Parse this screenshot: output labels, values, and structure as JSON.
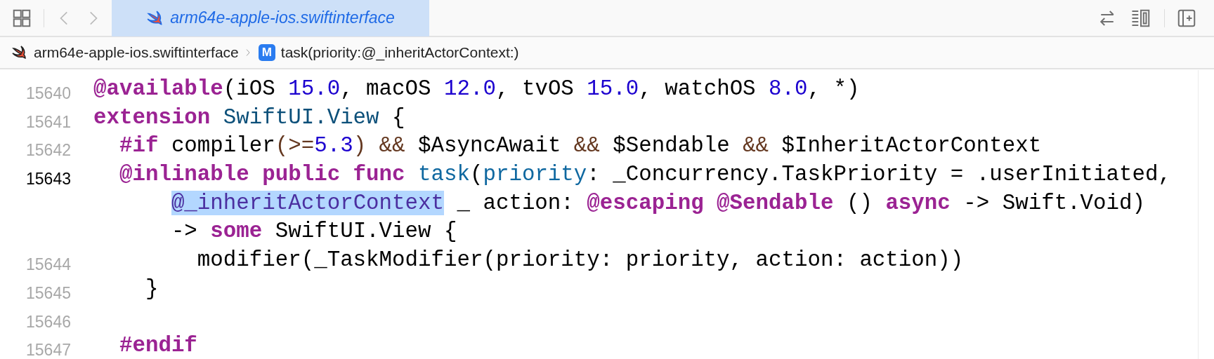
{
  "tab_bar": {
    "tabs": [
      {
        "label": "arm64e-apple-ios.swiftinterface",
        "selected": true
      }
    ]
  },
  "breadcrumb": [
    {
      "kind": "file",
      "label": "arm64e-apple-ios.swiftinterface"
    },
    {
      "kind": "method",
      "badge": "M",
      "label": "task(priority:@_inheritActorContext:)"
    }
  ],
  "editor": {
    "lines": [
      {
        "number": "15640",
        "current": false,
        "tokens": [
          {
            "text": "@available",
            "kind": "keyword"
          },
          {
            "text": "(iOS ",
            "kind": "plain"
          },
          {
            "text": "15.0",
            "kind": "number"
          },
          {
            "text": ", macOS ",
            "kind": "plain"
          },
          {
            "text": "12.0",
            "kind": "number"
          },
          {
            "text": ", tvOS ",
            "kind": "plain"
          },
          {
            "text": "15.0",
            "kind": "number"
          },
          {
            "text": ", watchOS ",
            "kind": "plain"
          },
          {
            "text": "8.0",
            "kind": "number"
          },
          {
            "text": ", *)",
            "kind": "plain"
          }
        ]
      },
      {
        "number": "15641",
        "current": false,
        "tokens": [
          {
            "text": "extension ",
            "kind": "keyword"
          },
          {
            "text": "SwiftUI.View",
            "kind": "type"
          },
          {
            "text": " {",
            "kind": "plain"
          }
        ]
      },
      {
        "number": "15642",
        "current": false,
        "tokens": [
          {
            "text": "  #if",
            "kind": "keyword"
          },
          {
            "text": " compiler",
            "kind": "plain"
          },
          {
            "text": "(>=",
            "kind": "operator"
          },
          {
            "text": "5.3",
            "kind": "number"
          },
          {
            "text": ") &&",
            "kind": "operator"
          },
          {
            "text": " $AsyncAwait ",
            "kind": "plain"
          },
          {
            "text": "&&",
            "kind": "operator"
          },
          {
            "text": " $Sendable ",
            "kind": "plain"
          },
          {
            "text": "&&",
            "kind": "operator"
          },
          {
            "text": " $InheritActorContext",
            "kind": "plain"
          }
        ]
      },
      {
        "number": "15643",
        "current": true,
        "tokens": [
          {
            "text": "  @inlinable public func ",
            "kind": "keyword"
          },
          {
            "text": "task",
            "kind": "declaration"
          },
          {
            "text": "(",
            "kind": "plain"
          },
          {
            "text": "priority",
            "kind": "declaration"
          },
          {
            "text": ": _Concurrency.TaskPriority = .userInitiated,",
            "kind": "plain"
          }
        ]
      },
      {
        "tokens": [
          {
            "text": "      @_inheritActorContext",
            "kind": "selection"
          },
          {
            "text": " _ action: ",
            "kind": "plain"
          },
          {
            "text": "@escaping @Sendable",
            "kind": "keyword"
          },
          {
            "text": " () ",
            "kind": "plain"
          },
          {
            "text": "async",
            "kind": "keyword"
          },
          {
            "text": " -> Swift.Void)",
            "kind": "plain"
          }
        ]
      },
      {
        "tokens": [
          {
            "text": "      -> ",
            "kind": "plain"
          },
          {
            "text": "some",
            "kind": "keyword"
          },
          {
            "text": " SwiftUI.View {",
            "kind": "plain"
          }
        ]
      },
      {
        "number": "15644",
        "current": false,
        "tokens": [
          {
            "text": "        modifier(_TaskModifier(priority: priority, action: action))",
            "kind": "plain"
          }
        ]
      },
      {
        "number": "15645",
        "current": false,
        "tokens": [
          {
            "text": "    }",
            "kind": "plain"
          }
        ]
      },
      {
        "number": "15646",
        "current": false
      },
      {
        "number": "15647",
        "current": false,
        "tokens": [
          {
            "text": "  #endif",
            "kind": "keyword"
          }
        ]
      }
    ]
  }
}
